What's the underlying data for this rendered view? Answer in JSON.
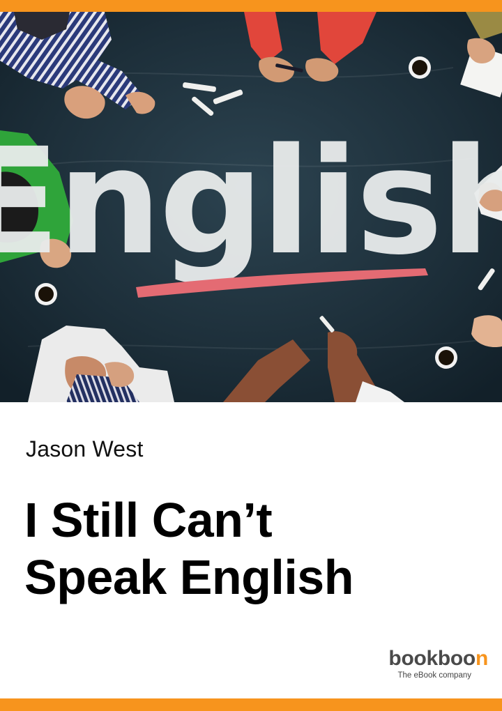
{
  "cover": {
    "board_word": "English",
    "author": "Jason West",
    "title_lines": [
      "I Still Can’t",
      "Speak English"
    ],
    "publisher": {
      "name_main": "bookboo",
      "name_accent": "n",
      "tagline": "The eBook company"
    }
  },
  "icons": {
    "cover_illustration": "chalkboard-people-illustration"
  },
  "colors": {
    "accent_bar": "#f7941d",
    "board": "#1d2f3a",
    "chalk": "#e9ecec",
    "chalk_underline": "#e46b73",
    "title_text": "#000000",
    "logo_main": "#4a4a4a",
    "logo_accent": "#f7941d"
  }
}
